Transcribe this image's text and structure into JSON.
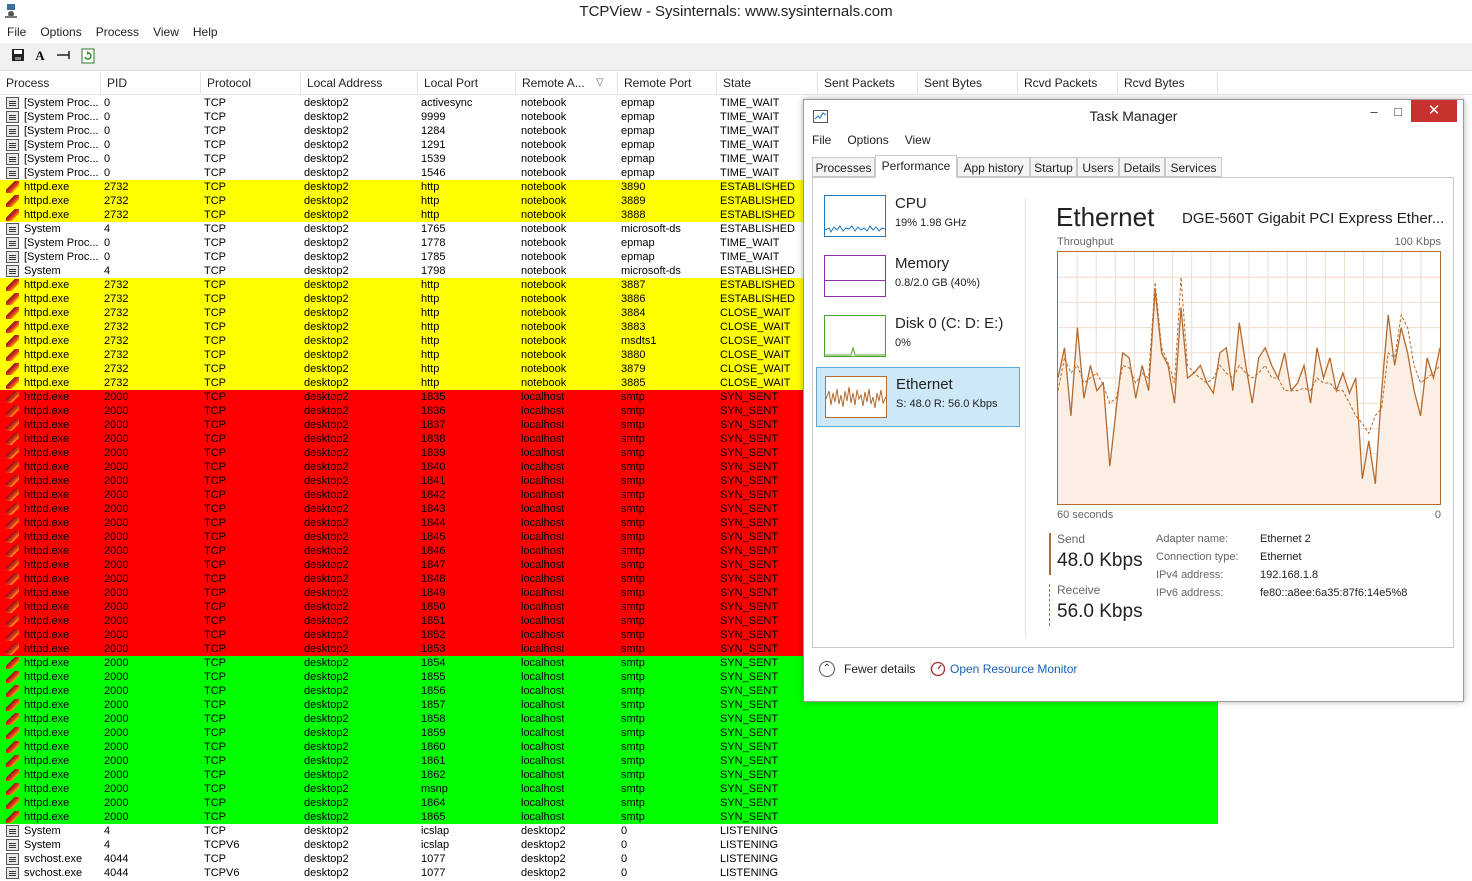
{
  "window": {
    "title": "TCPView - Sysinternals: www.sysinternals.com"
  },
  "menu": [
    "File",
    "Options",
    "Process",
    "View",
    "Help"
  ],
  "toolbar": {
    "icons": [
      "save-icon",
      "font-icon",
      "resolve-icon",
      "refresh-icon"
    ],
    "font_glyph": "A"
  },
  "columns": [
    "Process",
    "PID",
    "Protocol",
    "Local Address",
    "Local Port",
    "Remote A...",
    "Remote Port",
    "State",
    "Sent Packets",
    "Sent Bytes",
    "Rcvd Packets",
    "Rcvd Bytes"
  ],
  "colors": {
    "yellow": "#ffff00",
    "red": "#ff0000",
    "green": "#00ff00",
    "white": "#ffffff"
  },
  "rows": [
    {
      "process": "[System Proc...",
      "pid": "0",
      "protocol": "TCP",
      "local_address": "desktop2",
      "local_port": "activesync",
      "remote_address": "notebook",
      "remote_port": "epmap",
      "state": "TIME_WAIT",
      "color": "white",
      "icon": "system"
    },
    {
      "process": "[System Proc...",
      "pid": "0",
      "protocol": "TCP",
      "local_address": "desktop2",
      "local_port": "9999",
      "remote_address": "notebook",
      "remote_port": "epmap",
      "state": "TIME_WAIT",
      "color": "white",
      "icon": "system"
    },
    {
      "process": "[System Proc...",
      "pid": "0",
      "protocol": "TCP",
      "local_address": "desktop2",
      "local_port": "1284",
      "remote_address": "notebook",
      "remote_port": "epmap",
      "state": "TIME_WAIT",
      "color": "white",
      "icon": "system"
    },
    {
      "process": "[System Proc...",
      "pid": "0",
      "protocol": "TCP",
      "local_address": "desktop2",
      "local_port": "1291",
      "remote_address": "notebook",
      "remote_port": "epmap",
      "state": "TIME_WAIT",
      "color": "white",
      "icon": "system"
    },
    {
      "process": "[System Proc...",
      "pid": "0",
      "protocol": "TCP",
      "local_address": "desktop2",
      "local_port": "1539",
      "remote_address": "notebook",
      "remote_port": "epmap",
      "state": "TIME_WAIT",
      "color": "white",
      "icon": "system"
    },
    {
      "process": "[System Proc...",
      "pid": "0",
      "protocol": "TCP",
      "local_address": "desktop2",
      "local_port": "1546",
      "remote_address": "notebook",
      "remote_port": "epmap",
      "state": "TIME_WAIT",
      "color": "white",
      "icon": "system"
    },
    {
      "process": "httpd.exe",
      "pid": "2732",
      "protocol": "TCP",
      "local_address": "desktop2",
      "local_port": "http",
      "remote_address": "notebook",
      "remote_port": "3890",
      "state": "ESTABLISHED",
      "color": "yellow",
      "icon": "feather"
    },
    {
      "process": "httpd.exe",
      "pid": "2732",
      "protocol": "TCP",
      "local_address": "desktop2",
      "local_port": "http",
      "remote_address": "notebook",
      "remote_port": "3889",
      "state": "ESTABLISHED",
      "color": "yellow",
      "icon": "feather"
    },
    {
      "process": "httpd.exe",
      "pid": "2732",
      "protocol": "TCP",
      "local_address": "desktop2",
      "local_port": "http",
      "remote_address": "notebook",
      "remote_port": "3888",
      "state": "ESTABLISHED",
      "color": "yellow",
      "icon": "feather"
    },
    {
      "process": "System",
      "pid": "4",
      "protocol": "TCP",
      "local_address": "desktop2",
      "local_port": "1765",
      "remote_address": "notebook",
      "remote_port": "microsoft-ds",
      "state": "ESTABLISHED",
      "color": "white",
      "icon": "system"
    },
    {
      "process": "[System Proc...",
      "pid": "0",
      "protocol": "TCP",
      "local_address": "desktop2",
      "local_port": "1778",
      "remote_address": "notebook",
      "remote_port": "epmap",
      "state": "TIME_WAIT",
      "color": "white",
      "icon": "system"
    },
    {
      "process": "[System Proc...",
      "pid": "0",
      "protocol": "TCP",
      "local_address": "desktop2",
      "local_port": "1785",
      "remote_address": "notebook",
      "remote_port": "epmap",
      "state": "TIME_WAIT",
      "color": "white",
      "icon": "system"
    },
    {
      "process": "System",
      "pid": "4",
      "protocol": "TCP",
      "local_address": "desktop2",
      "local_port": "1798",
      "remote_address": "notebook",
      "remote_port": "microsoft-ds",
      "state": "ESTABLISHED",
      "color": "white",
      "icon": "system"
    },
    {
      "process": "httpd.exe",
      "pid": "2732",
      "protocol": "TCP",
      "local_address": "desktop2",
      "local_port": "http",
      "remote_address": "notebook",
      "remote_port": "3887",
      "state": "ESTABLISHED",
      "color": "yellow",
      "icon": "feather"
    },
    {
      "process": "httpd.exe",
      "pid": "2732",
      "protocol": "TCP",
      "local_address": "desktop2",
      "local_port": "http",
      "remote_address": "notebook",
      "remote_port": "3886",
      "state": "ESTABLISHED",
      "color": "yellow",
      "icon": "feather"
    },
    {
      "process": "httpd.exe",
      "pid": "2732",
      "protocol": "TCP",
      "local_address": "desktop2",
      "local_port": "http",
      "remote_address": "notebook",
      "remote_port": "3884",
      "state": "CLOSE_WAIT",
      "color": "yellow",
      "icon": "feather"
    },
    {
      "process": "httpd.exe",
      "pid": "2732",
      "protocol": "TCP",
      "local_address": "desktop2",
      "local_port": "http",
      "remote_address": "notebook",
      "remote_port": "3883",
      "state": "CLOSE_WAIT",
      "color": "yellow",
      "icon": "feather"
    },
    {
      "process": "httpd.exe",
      "pid": "2732",
      "protocol": "TCP",
      "local_address": "desktop2",
      "local_port": "http",
      "remote_address": "notebook",
      "remote_port": "msdts1",
      "state": "CLOSE_WAIT",
      "color": "yellow",
      "icon": "feather"
    },
    {
      "process": "httpd.exe",
      "pid": "2732",
      "protocol": "TCP",
      "local_address": "desktop2",
      "local_port": "http",
      "remote_address": "notebook",
      "remote_port": "3880",
      "state": "CLOSE_WAIT",
      "color": "yellow",
      "icon": "feather"
    },
    {
      "process": "httpd.exe",
      "pid": "2732",
      "protocol": "TCP",
      "local_address": "desktop2",
      "local_port": "http",
      "remote_address": "notebook",
      "remote_port": "3879",
      "state": "CLOSE_WAIT",
      "color": "yellow",
      "icon": "feather"
    },
    {
      "process": "httpd.exe",
      "pid": "2732",
      "protocol": "TCP",
      "local_address": "desktop2",
      "local_port": "http",
      "remote_address": "notebook",
      "remote_port": "3885",
      "state": "CLOSE_WAIT",
      "color": "yellow",
      "icon": "feather"
    },
    {
      "process": "httpd.exe",
      "pid": "2000",
      "protocol": "TCP",
      "local_address": "desktop2",
      "local_port": "1835",
      "remote_address": "localhost",
      "remote_port": "smtp",
      "state": "SYN_SENT",
      "color": "red",
      "icon": "feather"
    },
    {
      "process": "httpd.exe",
      "pid": "2000",
      "protocol": "TCP",
      "local_address": "desktop2",
      "local_port": "1836",
      "remote_address": "localhost",
      "remote_port": "smtp",
      "state": "SYN_SENT",
      "color": "red",
      "icon": "feather"
    },
    {
      "process": "httpd.exe",
      "pid": "2000",
      "protocol": "TCP",
      "local_address": "desktop2",
      "local_port": "1837",
      "remote_address": "localhost",
      "remote_port": "smtp",
      "state": "SYN_SENT",
      "color": "red",
      "icon": "feather"
    },
    {
      "process": "httpd.exe",
      "pid": "2000",
      "protocol": "TCP",
      "local_address": "desktop2",
      "local_port": "1838",
      "remote_address": "localhost",
      "remote_port": "smtp",
      "state": "SYN_SENT",
      "color": "red",
      "icon": "feather"
    },
    {
      "process": "httpd.exe",
      "pid": "2000",
      "protocol": "TCP",
      "local_address": "desktop2",
      "local_port": "1839",
      "remote_address": "localhost",
      "remote_port": "smtp",
      "state": "SYN_SENT",
      "color": "red",
      "icon": "feather"
    },
    {
      "process": "httpd.exe",
      "pid": "2000",
      "protocol": "TCP",
      "local_address": "desktop2",
      "local_port": "1840",
      "remote_address": "localhost",
      "remote_port": "smtp",
      "state": "SYN_SENT",
      "color": "red",
      "icon": "feather"
    },
    {
      "process": "httpd.exe",
      "pid": "2000",
      "protocol": "TCP",
      "local_address": "desktop2",
      "local_port": "1841",
      "remote_address": "localhost",
      "remote_port": "smtp",
      "state": "SYN_SENT",
      "color": "red",
      "icon": "feather"
    },
    {
      "process": "httpd.exe",
      "pid": "2000",
      "protocol": "TCP",
      "local_address": "desktop2",
      "local_port": "1842",
      "remote_address": "localhost",
      "remote_port": "smtp",
      "state": "SYN_SENT",
      "color": "red",
      "icon": "feather"
    },
    {
      "process": "httpd.exe",
      "pid": "2000",
      "protocol": "TCP",
      "local_address": "desktop2",
      "local_port": "1843",
      "remote_address": "localhost",
      "remote_port": "smtp",
      "state": "SYN_SENT",
      "color": "red",
      "icon": "feather"
    },
    {
      "process": "httpd.exe",
      "pid": "2000",
      "protocol": "TCP",
      "local_address": "desktop2",
      "local_port": "1844",
      "remote_address": "localhost",
      "remote_port": "smtp",
      "state": "SYN_SENT",
      "color": "red",
      "icon": "feather"
    },
    {
      "process": "httpd.exe",
      "pid": "2000",
      "protocol": "TCP",
      "local_address": "desktop2",
      "local_port": "1845",
      "remote_address": "localhost",
      "remote_port": "smtp",
      "state": "SYN_SENT",
      "color": "red",
      "icon": "feather"
    },
    {
      "process": "httpd.exe",
      "pid": "2000",
      "protocol": "TCP",
      "local_address": "desktop2",
      "local_port": "1846",
      "remote_address": "localhost",
      "remote_port": "smtp",
      "state": "SYN_SENT",
      "color": "red",
      "icon": "feather"
    },
    {
      "process": "httpd.exe",
      "pid": "2000",
      "protocol": "TCP",
      "local_address": "desktop2",
      "local_port": "1847",
      "remote_address": "localhost",
      "remote_port": "smtp",
      "state": "SYN_SENT",
      "color": "red",
      "icon": "feather"
    },
    {
      "process": "httpd.exe",
      "pid": "2000",
      "protocol": "TCP",
      "local_address": "desktop2",
      "local_port": "1848",
      "remote_address": "localhost",
      "remote_port": "smtp",
      "state": "SYN_SENT",
      "color": "red",
      "icon": "feather"
    },
    {
      "process": "httpd.exe",
      "pid": "2000",
      "protocol": "TCP",
      "local_address": "desktop2",
      "local_port": "1849",
      "remote_address": "localhost",
      "remote_port": "smtp",
      "state": "SYN_SENT",
      "color": "red",
      "icon": "feather"
    },
    {
      "process": "httpd.exe",
      "pid": "2000",
      "protocol": "TCP",
      "local_address": "desktop2",
      "local_port": "1850",
      "remote_address": "localhost",
      "remote_port": "smtp",
      "state": "SYN_SENT",
      "color": "red",
      "icon": "feather"
    },
    {
      "process": "httpd.exe",
      "pid": "2000",
      "protocol": "TCP",
      "local_address": "desktop2",
      "local_port": "1851",
      "remote_address": "localhost",
      "remote_port": "smtp",
      "state": "SYN_SENT",
      "color": "red",
      "icon": "feather"
    },
    {
      "process": "httpd.exe",
      "pid": "2000",
      "protocol": "TCP",
      "local_address": "desktop2",
      "local_port": "1852",
      "remote_address": "localhost",
      "remote_port": "smtp",
      "state": "SYN_SENT",
      "color": "red",
      "icon": "feather"
    },
    {
      "process": "httpd.exe",
      "pid": "2000",
      "protocol": "TCP",
      "local_address": "desktop2",
      "local_port": "1853",
      "remote_address": "localhost",
      "remote_port": "smtp",
      "state": "SYN_SENT",
      "color": "red",
      "icon": "feather"
    },
    {
      "process": "httpd.exe",
      "pid": "2000",
      "protocol": "TCP",
      "local_address": "desktop2",
      "local_port": "1854",
      "remote_address": "localhost",
      "remote_port": "smtp",
      "state": "SYN_SENT",
      "color": "green",
      "icon": "feather"
    },
    {
      "process": "httpd.exe",
      "pid": "2000",
      "protocol": "TCP",
      "local_address": "desktop2",
      "local_port": "1855",
      "remote_address": "localhost",
      "remote_port": "smtp",
      "state": "SYN_SENT",
      "color": "green",
      "icon": "feather"
    },
    {
      "process": "httpd.exe",
      "pid": "2000",
      "protocol": "TCP",
      "local_address": "desktop2",
      "local_port": "1856",
      "remote_address": "localhost",
      "remote_port": "smtp",
      "state": "SYN_SENT",
      "color": "green",
      "icon": "feather"
    },
    {
      "process": "httpd.exe",
      "pid": "2000",
      "protocol": "TCP",
      "local_address": "desktop2",
      "local_port": "1857",
      "remote_address": "localhost",
      "remote_port": "smtp",
      "state": "SYN_SENT",
      "color": "green",
      "icon": "feather"
    },
    {
      "process": "httpd.exe",
      "pid": "2000",
      "protocol": "TCP",
      "local_address": "desktop2",
      "local_port": "1858",
      "remote_address": "localhost",
      "remote_port": "smtp",
      "state": "SYN_SENT",
      "color": "green",
      "icon": "feather"
    },
    {
      "process": "httpd.exe",
      "pid": "2000",
      "protocol": "TCP",
      "local_address": "desktop2",
      "local_port": "1859",
      "remote_address": "localhost",
      "remote_port": "smtp",
      "state": "SYN_SENT",
      "color": "green",
      "icon": "feather"
    },
    {
      "process": "httpd.exe",
      "pid": "2000",
      "protocol": "TCP",
      "local_address": "desktop2",
      "local_port": "1860",
      "remote_address": "localhost",
      "remote_port": "smtp",
      "state": "SYN_SENT",
      "color": "green",
      "icon": "feather"
    },
    {
      "process": "httpd.exe",
      "pid": "2000",
      "protocol": "TCP",
      "local_address": "desktop2",
      "local_port": "1861",
      "remote_address": "localhost",
      "remote_port": "smtp",
      "state": "SYN_SENT",
      "color": "green",
      "icon": "feather"
    },
    {
      "process": "httpd.exe",
      "pid": "2000",
      "protocol": "TCP",
      "local_address": "desktop2",
      "local_port": "1862",
      "remote_address": "localhost",
      "remote_port": "smtp",
      "state": "SYN_SENT",
      "color": "green",
      "icon": "feather"
    },
    {
      "process": "httpd.exe",
      "pid": "2000",
      "protocol": "TCP",
      "local_address": "desktop2",
      "local_port": "msnp",
      "remote_address": "localhost",
      "remote_port": "smtp",
      "state": "SYN_SENT",
      "color": "green",
      "icon": "feather"
    },
    {
      "process": "httpd.exe",
      "pid": "2000",
      "protocol": "TCP",
      "local_address": "desktop2",
      "local_port": "1864",
      "remote_address": "localhost",
      "remote_port": "smtp",
      "state": "SYN_SENT",
      "color": "green",
      "icon": "feather"
    },
    {
      "process": "httpd.exe",
      "pid": "2000",
      "protocol": "TCP",
      "local_address": "desktop2",
      "local_port": "1865",
      "remote_address": "localhost",
      "remote_port": "smtp",
      "state": "SYN_SENT",
      "color": "green",
      "icon": "feather"
    },
    {
      "process": "System",
      "pid": "4",
      "protocol": "TCP",
      "local_address": "desktop2",
      "local_port": "icslap",
      "remote_address": "desktop2",
      "remote_port": "0",
      "state": "LISTENING",
      "color": "white",
      "icon": "system"
    },
    {
      "process": "System",
      "pid": "4",
      "protocol": "TCPV6",
      "local_address": "desktop2",
      "local_port": "icslap",
      "remote_address": "desktop2",
      "remote_port": "0",
      "state": "LISTENING",
      "color": "white",
      "icon": "system"
    },
    {
      "process": "svchost.exe",
      "pid": "4044",
      "protocol": "TCP",
      "local_address": "desktop2",
      "local_port": "1077",
      "remote_address": "desktop2",
      "remote_port": "0",
      "state": "LISTENING",
      "color": "white",
      "icon": "system"
    },
    {
      "process": "svchost.exe",
      "pid": "4044",
      "protocol": "TCPV6",
      "local_address": "desktop2",
      "local_port": "1077",
      "remote_address": "desktop2",
      "remote_port": "0",
      "state": "LISTENING",
      "color": "white",
      "icon": "system"
    }
  ],
  "task_manager": {
    "title": "Task Manager",
    "window_controls": {
      "minimize": "‒",
      "maximize": "□",
      "close": "✕"
    },
    "menu": [
      "File",
      "Options",
      "View"
    ],
    "tabs": [
      "Processes",
      "Performance",
      "App history",
      "Startup",
      "Users",
      "Details",
      "Services"
    ],
    "active_tab": "Performance",
    "side_items": [
      {
        "name": "CPU",
        "sub": "19%  1.98 GHz",
        "color": "#1f7ac2"
      },
      {
        "name": "Memory",
        "sub": "0.8/2.0 GB (40%)",
        "color": "#8b2fa8"
      },
      {
        "name": "Disk 0 (C: D: E:)",
        "sub": "0%",
        "color": "#4aa02c"
      },
      {
        "name": "Ethernet",
        "sub": "S: 48.0  R: 56.0 Kbps",
        "color": "#b56a2e"
      }
    ],
    "detail_title": "Ethernet",
    "adapter": "DGE-560T Gigabit PCI Express Ether...",
    "throughput_label": "Throughput",
    "max_label": "100 Kbps",
    "time_label": "60 seconds",
    "zero_label": "0",
    "send_label": "Send",
    "send_value": "48.0 Kbps",
    "receive_label": "Receive",
    "receive_value": "56.0 Kbps",
    "info": [
      {
        "k": "Adapter name:",
        "v": "Ethernet 2"
      },
      {
        "k": "Connection type:",
        "v": "Ethernet"
      },
      {
        "k": "IPv4 address:",
        "v": "192.168.1.8"
      },
      {
        "k": "IPv6 address:",
        "v": "fe80::a8ee:6a35:87f6:14e5%8"
      }
    ],
    "fewer_details": "Fewer details",
    "fewer_glyph": "⌃",
    "open_monitor": "Open Resource Monitor",
    "link_color": "#1a5fb4",
    "receive_series": [
      50,
      62,
      35,
      70,
      42,
      55,
      45,
      48,
      15,
      38,
      60,
      58,
      42,
      55,
      45,
      85,
      60,
      55,
      40,
      78,
      50,
      52,
      55,
      48,
      44,
      60,
      62,
      45,
      72,
      55,
      40,
      58,
      62,
      55,
      50,
      60,
      45,
      48,
      55,
      40,
      62,
      50,
      58,
      45,
      52,
      44,
      50,
      10,
      25,
      8,
      45,
      75,
      55,
      70,
      60,
      45,
      35,
      58,
      50,
      62
    ],
    "send_series": [
      45,
      58,
      52,
      55,
      48,
      50,
      52,
      47,
      40,
      42,
      55,
      54,
      48,
      52,
      50,
      88,
      62,
      56,
      48,
      90,
      55,
      52,
      50,
      48,
      50,
      55,
      52,
      50,
      55,
      52,
      50,
      52,
      55,
      50,
      50,
      45,
      45,
      45,
      46,
      45,
      50,
      48,
      48,
      45,
      45,
      40,
      35,
      32,
      28,
      35,
      38,
      60,
      58,
      75,
      70,
      55,
      48,
      50,
      52,
      55
    ]
  }
}
